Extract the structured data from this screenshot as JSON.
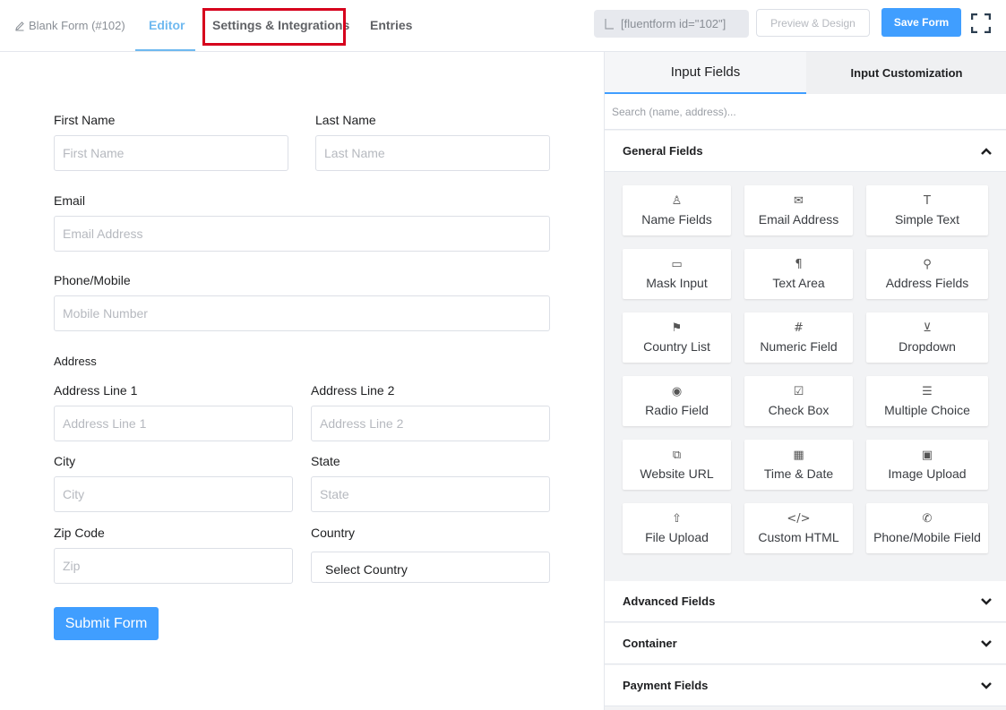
{
  "header": {
    "form_name": "Blank Form (#102)",
    "tabs": {
      "editor": "Editor",
      "settings": "Settings & Integrations",
      "entries": "Entries"
    },
    "shortcode": "[fluentform id=\"102\"]",
    "preview_label": "Preview & Design",
    "save_label": "Save Form"
  },
  "form": {
    "first_name": {
      "label": "First Name",
      "placeholder": "First Name"
    },
    "last_name": {
      "label": "Last Name",
      "placeholder": "Last Name"
    },
    "email": {
      "label": "Email",
      "placeholder": "Email Address"
    },
    "phone": {
      "label": "Phone/Mobile",
      "placeholder": "Mobile Number"
    },
    "address": {
      "section_label": "Address",
      "line1": {
        "label": "Address Line 1",
        "placeholder": "Address Line 1"
      },
      "line2": {
        "label": "Address Line 2",
        "placeholder": "Address Line 2"
      },
      "city": {
        "label": "City",
        "placeholder": "City"
      },
      "state": {
        "label": "State",
        "placeholder": "State"
      },
      "zip": {
        "label": "Zip Code",
        "placeholder": "Zip"
      },
      "country": {
        "label": "Country",
        "value": "Select Country"
      }
    },
    "submit_label": "Submit Form"
  },
  "panel": {
    "tabs": {
      "input_fields": "Input Fields",
      "customization": "Input Customization"
    },
    "search_placeholder": "Search (name, address)...",
    "general_fields": {
      "title": "General Fields",
      "items": [
        {
          "label": "Name Fields",
          "icon": "person-icon",
          "glyph": "♙"
        },
        {
          "label": "Email Address",
          "icon": "envelope-icon",
          "glyph": "✉"
        },
        {
          "label": "Simple Text",
          "icon": "text-cursor-icon",
          "glyph": "T"
        },
        {
          "label": "Mask Input",
          "icon": "keyboard-icon",
          "glyph": "▭"
        },
        {
          "label": "Text Area",
          "icon": "paragraph-icon",
          "glyph": "¶"
        },
        {
          "label": "Address Fields",
          "icon": "map-pin-icon",
          "glyph": "⚲"
        },
        {
          "label": "Country List",
          "icon": "flag-icon",
          "glyph": "⚑"
        },
        {
          "label": "Numeric Field",
          "icon": "hash-icon",
          "glyph": "#"
        },
        {
          "label": "Dropdown",
          "icon": "dropdown-icon",
          "glyph": "⊻"
        },
        {
          "label": "Radio Field",
          "icon": "radio-icon",
          "glyph": "◉"
        },
        {
          "label": "Check Box",
          "icon": "checkbox-icon",
          "glyph": "☑"
        },
        {
          "label": "Multiple Choice",
          "icon": "list-icon",
          "glyph": "☰"
        },
        {
          "label": "Website URL",
          "icon": "link-icon",
          "glyph": "⧉"
        },
        {
          "label": "Time & Date",
          "icon": "calendar-icon",
          "glyph": "▦"
        },
        {
          "label": "Image Upload",
          "icon": "image-icon",
          "glyph": "▣"
        },
        {
          "label": "File Upload",
          "icon": "upload-icon",
          "glyph": "⇧"
        },
        {
          "label": "Custom HTML",
          "icon": "code-icon",
          "glyph": "</>"
        },
        {
          "label": "Phone/Mobile Field",
          "icon": "phone-icon",
          "glyph": "✆"
        }
      ]
    },
    "sections": {
      "advanced": "Advanced Fields",
      "container": "Container",
      "payment": "Payment Fields"
    }
  },
  "colors": {
    "accent": "#409eff",
    "highlight_border": "#d6001c",
    "active_tab": "#6fb9f0"
  }
}
